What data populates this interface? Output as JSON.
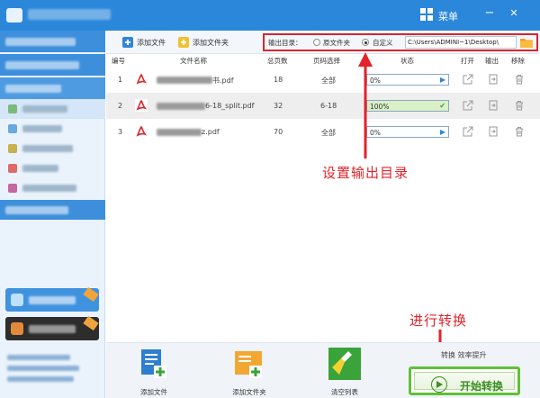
{
  "window": {
    "menu_label": "菜单",
    "minimize": "−",
    "close": "✕"
  },
  "toolbar": {
    "add_file_label": "添加文件",
    "add_folder_label": "添加文件夹",
    "output_dir_label": "输出目录：",
    "option_source": "原文件夹",
    "option_custom": "自定义",
    "selected_option": "custom",
    "path_value": "C:\\Users\\ADMINI~1\\Desktop\\"
  },
  "table": {
    "headers": {
      "index": "编号",
      "name": "文件名称",
      "pages": "总页数",
      "range": "页码选择",
      "status": "状态",
      "open": "打开",
      "output": "输出",
      "remove": "移除"
    },
    "rows": [
      {
        "index": "1",
        "name_visible": "书.pdf",
        "pages": "18",
        "range": "全部",
        "progress_text": "0%",
        "progress": 0,
        "done": false
      },
      {
        "index": "2",
        "name_visible": "6-18_split.pdf",
        "pages": "32",
        "range": "6-18",
        "progress_text": "100%",
        "progress": 100,
        "done": true
      },
      {
        "index": "3",
        "name_visible": "z.pdf",
        "pages": "70",
        "range": "全部",
        "progress_text": "0%",
        "progress": 0,
        "done": false
      }
    ]
  },
  "annotations": {
    "set_output": "设置输出目录",
    "convert": "进行转换"
  },
  "bottom": {
    "add_file_label": "添加文件",
    "add_folder_label": "添加文件夹",
    "clear_list_label": "清空列表",
    "tip": "转换 效率提升",
    "start_label": "开始转换"
  },
  "colors": {
    "title_bar": "#2b87da",
    "accent_red": "#e2232b",
    "start_green": "#5fc135"
  }
}
